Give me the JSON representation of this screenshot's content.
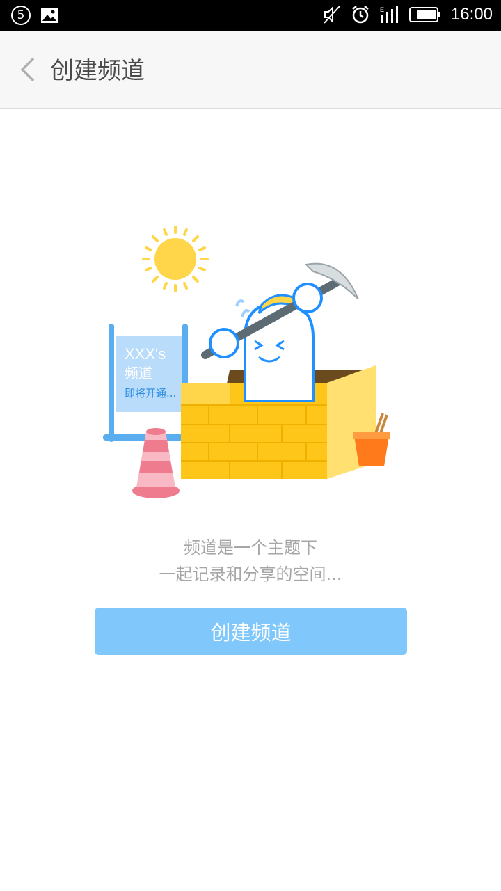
{
  "status_bar": {
    "notification_count": "5",
    "time": "16:00",
    "icons": [
      "notification-count-icon",
      "image-icon",
      "mute-icon",
      "alarm-icon",
      "signal-icon",
      "battery-icon"
    ]
  },
  "header": {
    "title": "创建频道"
  },
  "illustration": {
    "sign_title": "XXX's",
    "sign_subtitle": "频道",
    "sign_note": "即将开通..."
  },
  "description": {
    "line1": "频道是一个主题下",
    "line2": "一起记录和分享的空间..."
  },
  "create_button": {
    "label": "创建频道"
  },
  "colors": {
    "button": "#80c8fb",
    "header_bg": "#f7f7f7",
    "text_gray": "#a6a6a6"
  }
}
